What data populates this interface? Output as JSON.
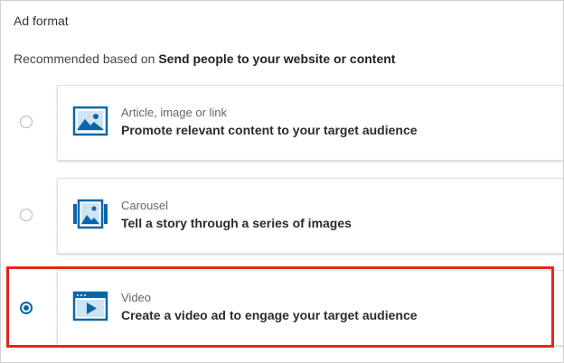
{
  "section": {
    "title": "Ad format",
    "recommend_prefix": "Recommended based on ",
    "recommend_objective": "Send people to your website or content"
  },
  "options": [
    {
      "icon": "image-icon",
      "label": "Article, image or link",
      "description": "Promote relevant content to your target audience",
      "selected": false
    },
    {
      "icon": "carousel-icon",
      "label": "Carousel",
      "description": "Tell a story through a series of images",
      "selected": false
    },
    {
      "icon": "video-icon",
      "label": "Video",
      "description": "Create a video ad to engage your target audience",
      "selected": true
    }
  ],
  "colors": {
    "accent": "#0a66a8",
    "highlight": "#e3261f"
  }
}
